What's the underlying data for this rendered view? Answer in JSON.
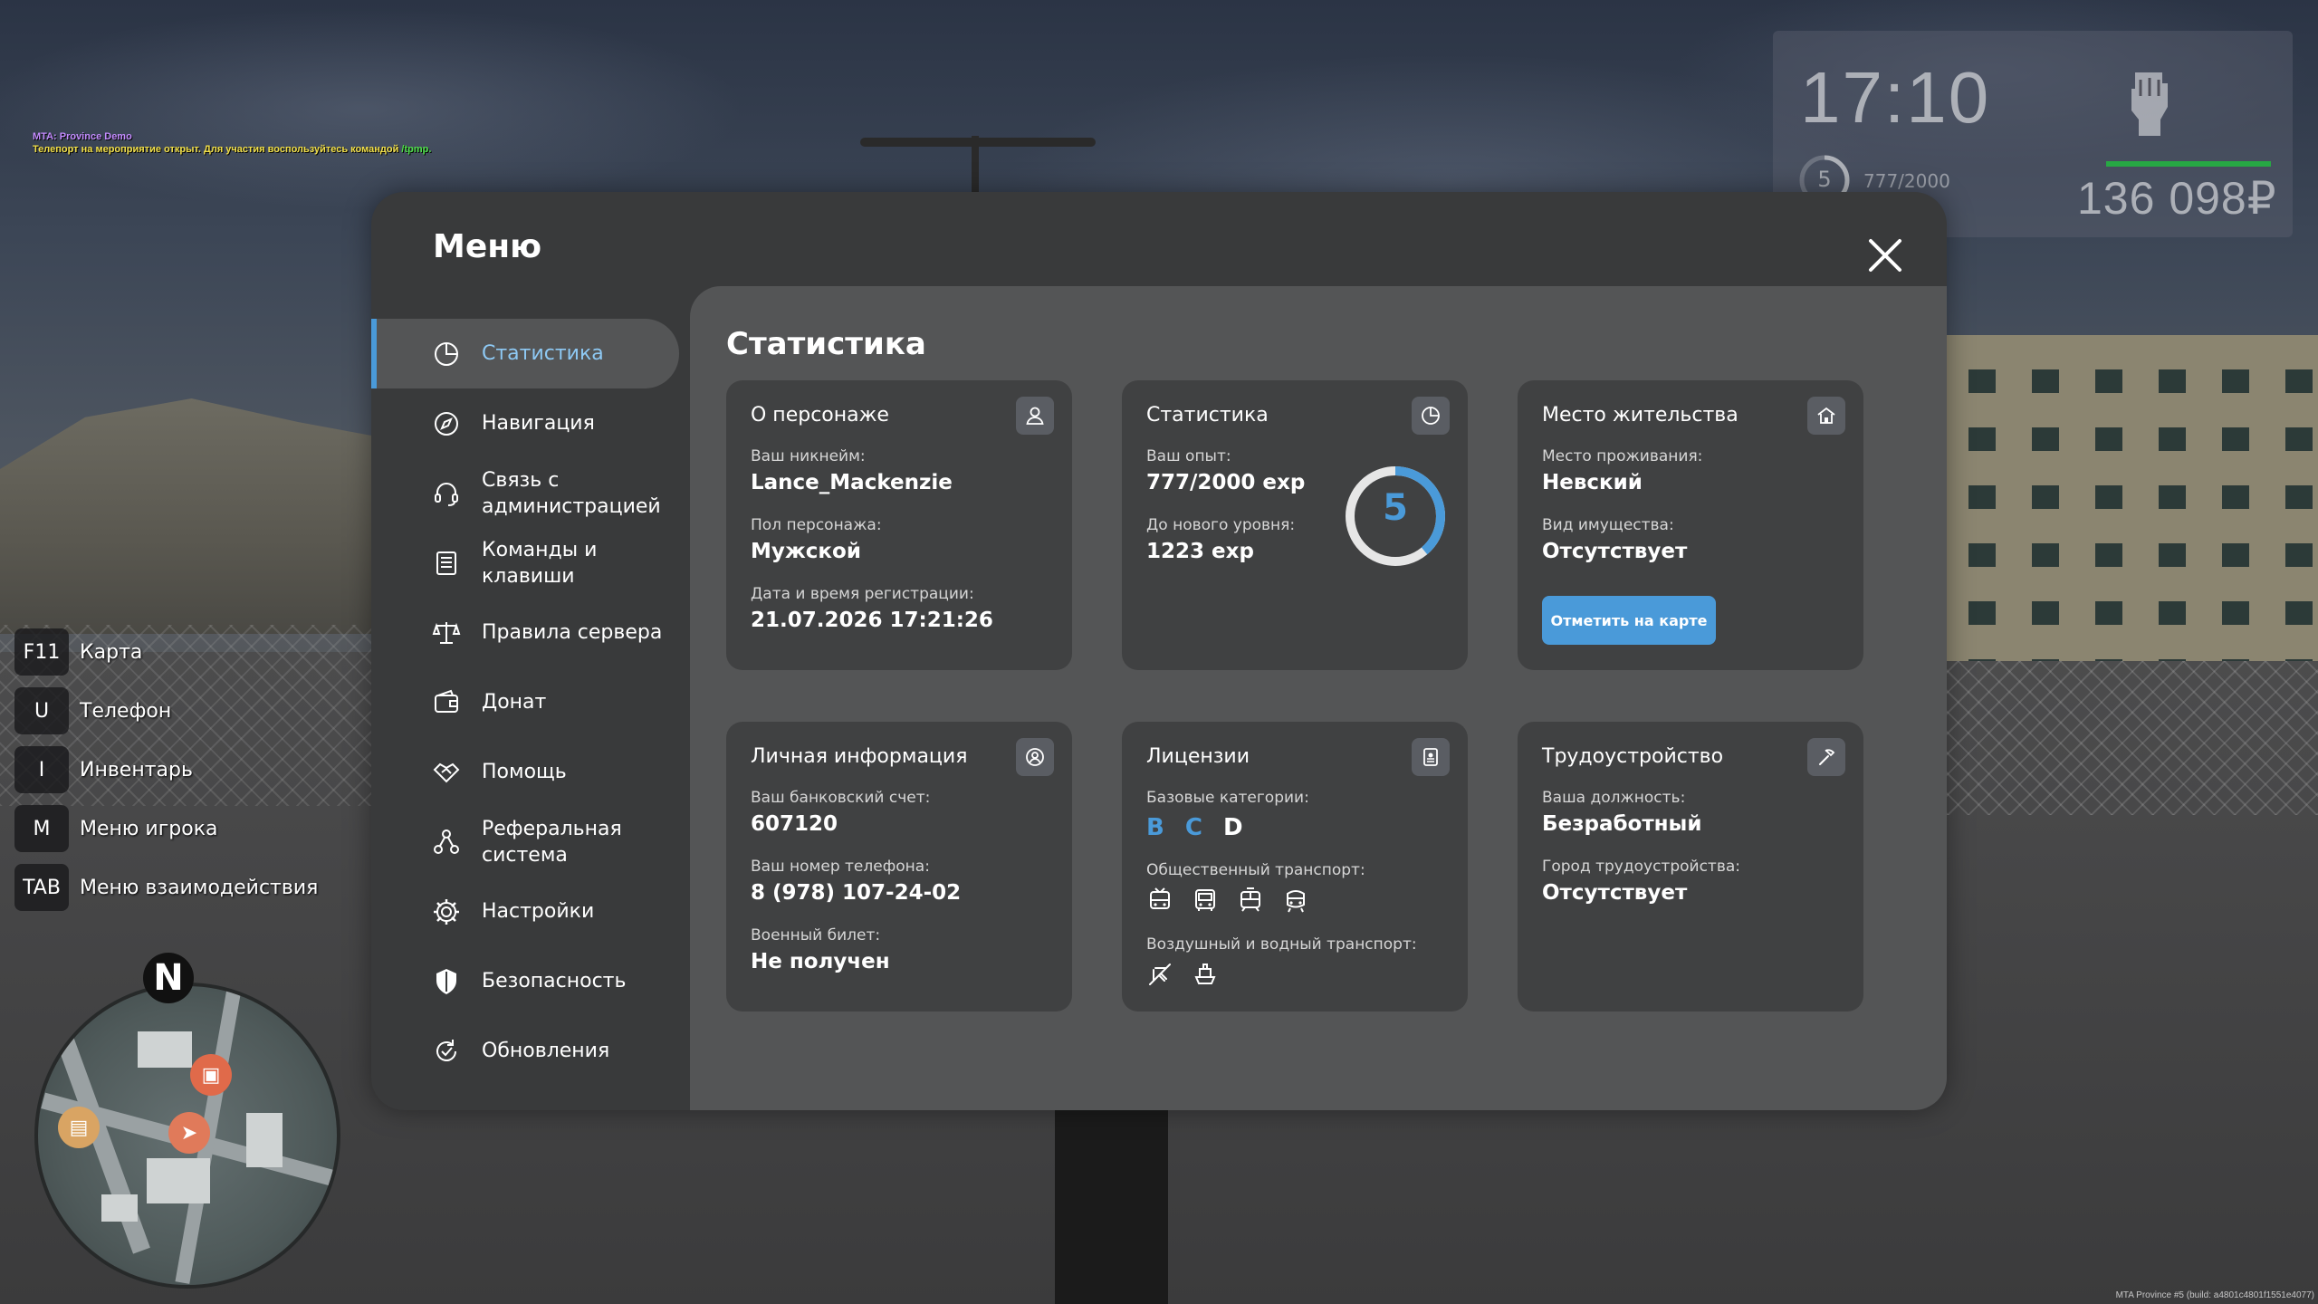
{
  "chat": {
    "line1": "MTA: Province Demo",
    "line2_text": "Телепорт на мероприятие открыт. Для участия воспользуйтесь командой ",
    "line2_command": "/tpmp."
  },
  "hud": {
    "time": "17:10",
    "level": "5",
    "exp": "777/2000",
    "money": "136 098₽",
    "health_fraction": 1.0,
    "exp_fraction": 0.3885
  },
  "keybinds": [
    {
      "key": "F11",
      "action": "Карта"
    },
    {
      "key": "U",
      "action": "Телефон"
    },
    {
      "key": "I",
      "action": "Инвентарь"
    },
    {
      "key": "M",
      "action": "Меню игрока"
    },
    {
      "key": "TAB",
      "action": "Меню взаимодействия"
    }
  ],
  "minimap": {
    "north": "N"
  },
  "build_info": "MTA Province #5 (build: a4801c4801f1551e4077)",
  "menu": {
    "title": "Меню",
    "nav": [
      {
        "label": "Статистика",
        "icon": "pie-chart-icon",
        "active": true
      },
      {
        "label": "Навигация",
        "icon": "compass-icon"
      },
      {
        "label": "Связь с\nадминистрацией",
        "icon": "headset-icon"
      },
      {
        "label": "Команды и\nклавиши",
        "icon": "list-icon"
      },
      {
        "label": "Правила сервера",
        "icon": "scales-icon"
      },
      {
        "label": "Донат",
        "icon": "wallet-icon"
      },
      {
        "label": "Помощь",
        "icon": "handshake-icon"
      },
      {
        "label": "Реферальная\nсистема",
        "icon": "referral-icon"
      },
      {
        "label": "Настройки",
        "icon": "gear-icon"
      },
      {
        "label": "Безопасность",
        "icon": "shield-icon"
      },
      {
        "label": "Обновления",
        "icon": "refresh-icon"
      }
    ]
  },
  "stats": {
    "title": "Статистика",
    "character": {
      "title": "О персонаже",
      "nick_label": "Ваш никнейм:",
      "nick": "Lance_Mackenzie",
      "gender_label": "Пол персонажа:",
      "gender": "Мужской",
      "reg_label": "Дата и время регистрации:",
      "reg": "21.07.2026 17:21:26"
    },
    "statistics": {
      "title": "Статистика",
      "exp_label": "Ваш опыт:",
      "exp": "777/2000 exp",
      "next_label": "До нового уровня:",
      "next": "1223 exp",
      "level": "5",
      "progress": 0.3885
    },
    "residence": {
      "title": "Место жительства",
      "place_label": "Место проживания:",
      "place": "Невский",
      "property_label": "Вид имущества:",
      "property": "Отсутствует",
      "button": "Отметить на карте"
    },
    "personal": {
      "title": "Личная информация",
      "bank_label": "Ваш банковский счет:",
      "bank": "607120",
      "phone_label": "Ваш номер телефона:",
      "phone": "8 (978) 107-24-02",
      "military_label": "Военный билет:",
      "military": "Не получен"
    },
    "licenses": {
      "title": "Лицензии",
      "base_label": "Базовые категории:",
      "categories": [
        {
          "letter": "B",
          "owned": true,
          "color": "#4a9ad9"
        },
        {
          "letter": "C",
          "owned": true,
          "color": "#4a9ad9"
        },
        {
          "letter": "D",
          "owned": false,
          "color": "#ffffff"
        }
      ],
      "public_label": "Общественный транспорт:",
      "air_label": "Воздушный и водный транспорт:"
    },
    "employment": {
      "title": "Трудоустройство",
      "position_label": "Ваша должность:",
      "position": "Безработный",
      "city_label": "Город трудоустройства:",
      "city": "Отсутствует"
    }
  }
}
